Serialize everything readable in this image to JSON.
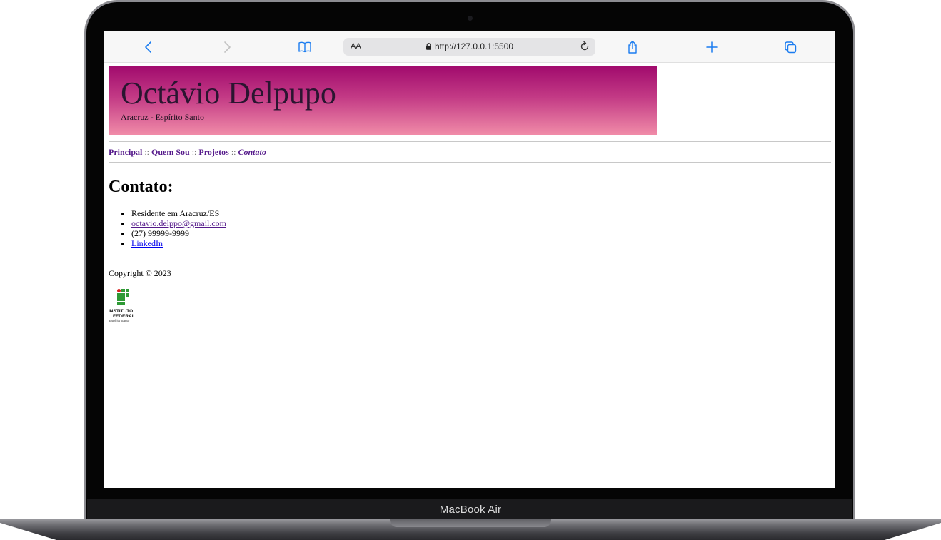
{
  "device": {
    "label": "MacBook Air"
  },
  "browser": {
    "text_size_label": "AA",
    "url": "http://127.0.0.1:5500",
    "icons": {
      "back": "chevron-left-icon",
      "forward": "chevron-right-icon",
      "bookmarks": "book-icon",
      "lock": "lock-icon",
      "reload": "reload-icon",
      "share": "share-icon",
      "new_tab": "plus-icon",
      "tabs": "tabs-icon"
    },
    "accent_color": "#1a7cf0"
  },
  "site": {
    "banner": {
      "title": "Octávio Delpupo",
      "subtitle": "Aracruz - Espírito Santo",
      "gradient": [
        "#a10b6d",
        "#f08ba8"
      ]
    },
    "nav": {
      "items": [
        {
          "label": "Principal"
        },
        {
          "label": "Quem Sou"
        },
        {
          "label": "Projetos"
        },
        {
          "label": "Contato"
        }
      ],
      "separator": "::"
    },
    "section_title": "Contato:",
    "contact_items": [
      {
        "text": "Residente em Aracruz/ES"
      },
      {
        "text": "octavio.delppo@gmail.com"
      },
      {
        "text": "(27) 99999-9999"
      },
      {
        "text": "LinkedIn"
      }
    ],
    "footer": {
      "copyright": "Copyright © 2023",
      "logo": {
        "line1": "INSTITUTO",
        "line2": "FEDERAL",
        "line3": "Espírito Santo",
        "colors": {
          "red": "#d6201f",
          "green": "#2e9a35"
        }
      }
    }
  }
}
